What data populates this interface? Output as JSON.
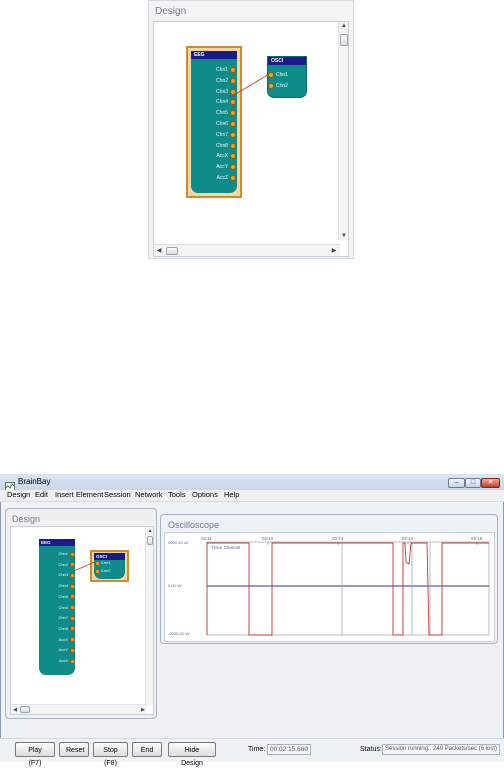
{
  "top_design": {
    "title": "Design",
    "eeg": {
      "title": "EEG",
      "ports": [
        "Chn1",
        "Chn2",
        "Chn3",
        "Chn4",
        "Chn5",
        "Chn6",
        "Chn7",
        "Chn8",
        "AccX",
        "AccY",
        "AccZ"
      ]
    },
    "osci": {
      "title": "OSCI",
      "ports": [
        "Chn1",
        "Chn2"
      ]
    }
  },
  "app": {
    "title": "BrainBay",
    "menu": [
      "Design",
      "Edit",
      "Insert Element",
      "Session",
      "Network",
      "Tools",
      "Options",
      "Help"
    ],
    "caption_buttons": {
      "minimize": "–",
      "maximize": "□",
      "close": "✕"
    }
  },
  "design_panel": {
    "title": "Design",
    "eeg": {
      "title": "EEG",
      "ports": [
        "Chn1",
        "Chn2",
        "Chn3",
        "Chn4",
        "Chn5",
        "Chn6",
        "Chn7",
        "Chn8",
        "AccX",
        "AccY",
        "AccZ"
      ]
    },
    "osci": {
      "title": "OSCI",
      "ports": [
        "Chn1",
        "Chn2"
      ]
    }
  },
  "oscilloscope": {
    "title": "Oscilloscope",
    "time_labels": [
      "02:11",
      "02:12",
      "02:13",
      "02:14",
      "02:15"
    ],
    "y_labels": [
      "2000.00 uV",
      "0.00 uV",
      "-2000.00 uV"
    ],
    "channel_label": "Trace Channel",
    "colors": {
      "trace": "#c0392b",
      "zero_line": "#2c3e70",
      "marker": "#8fa3b8"
    }
  },
  "toolbar": {
    "play_label": "Play (F7)",
    "reset_label": "Reset",
    "stop_label": "Stop (F8)",
    "end_label": "End",
    "hide_design_label": "Hide Design",
    "time_label": "Time:",
    "time_value": "00:02:15.660",
    "status_label": "Status:",
    "status_value": "Session running.. 240 Packets/sec (6 lost)"
  }
}
